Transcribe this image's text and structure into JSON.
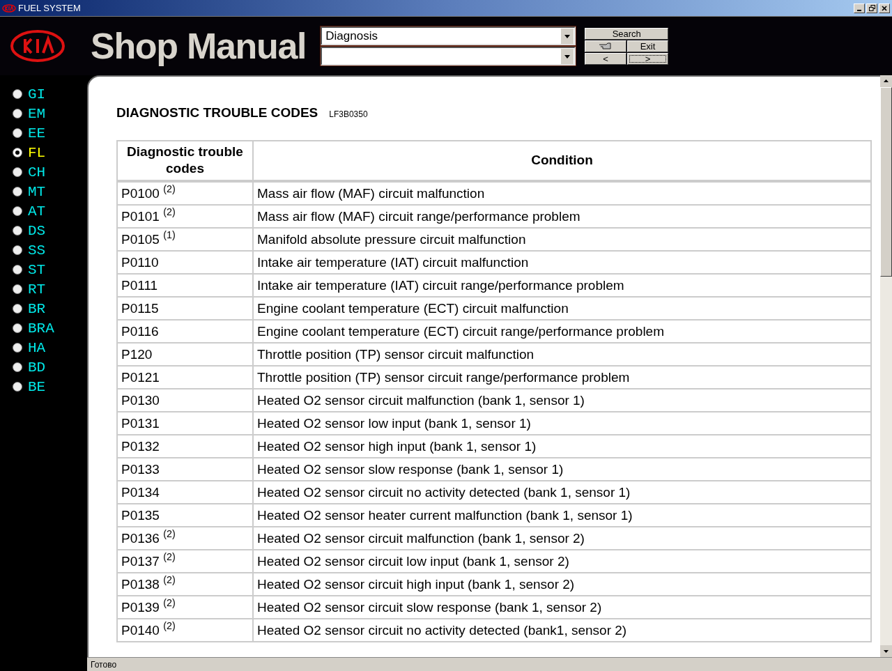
{
  "window": {
    "title": "FUEL SYSTEM"
  },
  "header": {
    "title": "Shop Manual",
    "selects": [
      {
        "kind": "filled",
        "value": "Diagnosis"
      },
      {
        "kind": "empty"
      }
    ],
    "buttons": [
      {
        "kind": "text",
        "label": "Search"
      },
      {
        "kind": "icon"
      },
      {
        "kind": "text",
        "label": "Exit"
      },
      {
        "kind": "text",
        "label": "<"
      },
      {
        "kind": "text",
        "label": ">",
        "focused": true
      }
    ]
  },
  "sidebar": {
    "items": [
      {
        "label": "GI",
        "selected": false
      },
      {
        "label": "EM",
        "selected": false
      },
      {
        "label": "EE",
        "selected": false
      },
      {
        "label": "FL",
        "selected": true
      },
      {
        "label": "CH",
        "selected": false
      },
      {
        "label": "MT",
        "selected": false
      },
      {
        "label": "AT",
        "selected": false
      },
      {
        "label": "DS",
        "selected": false
      },
      {
        "label": "SS",
        "selected": false
      },
      {
        "label": "ST",
        "selected": false
      },
      {
        "label": "RT",
        "selected": false
      },
      {
        "label": "BR",
        "selected": false
      },
      {
        "label": "BRA",
        "selected": false
      },
      {
        "label": "HA",
        "selected": false
      },
      {
        "label": "BD",
        "selected": false
      },
      {
        "label": "BE",
        "selected": false
      }
    ]
  },
  "document": {
    "title": "DIAGNOSTIC TROUBLE CODES",
    "doc_id": "LF3B0350"
  },
  "table": {
    "columns": [
      "Diagnostic trouble codes",
      "Condition"
    ],
    "rows": [
      {
        "code": "P0100 $^{(2)}$",
        "condition": "Mass air flow (MAF) circuit malfunction"
      },
      {
        "code": "P0101 $^{(2)}$",
        "condition": "Mass air flow (MAF) circuit range/performance problem"
      },
      {
        "code": "P0105 $^{(1)}$",
        "condition": "Manifold absolute pressure circuit malfunction"
      },
      {
        "code": "P0110",
        "condition": "Intake air temperature (IAT) circuit malfunction"
      },
      {
        "code": "P0111",
        "condition": "Intake air temperature (IAT) circuit range/performance problem"
      },
      {
        "code": "P0115",
        "condition": "Engine coolant temperature (ECT) circuit malfunction"
      },
      {
        "code": "P0116",
        "condition": "Engine coolant temperature (ECT) circuit range/performance problem"
      },
      {
        "code": "P120",
        "condition": "Throttle position (TP) sensor circuit malfunction"
      },
      {
        "code": "P0121",
        "condition": "Throttle position (TP) sensor circuit range/performance problem"
      },
      {
        "code": "P0130",
        "condition": "Heated O2 sensor circuit malfunction (bank 1, sensor 1)"
      },
      {
        "code": "P0131",
        "condition": "Heated O2 sensor low input (bank 1, sensor 1)"
      },
      {
        "code": "P0132",
        "condition": "Heated O2 sensor high input (bank 1, sensor 1)"
      },
      {
        "code": "P0133",
        "condition": "Heated O2 sensor slow response (bank 1, sensor 1)"
      },
      {
        "code": "P0134",
        "condition": "Heated O2 sensor circuit no activity detected (bank 1, sensor 1)"
      },
      {
        "code": "P0135",
        "condition": "Heated O2 sensor heater current malfunction (bank 1, sensor 1)"
      },
      {
        "code": "P0136 $^{(2)}$",
        "condition": "Heated O2 sensor circuit malfunction (bank 1, sensor 2)"
      },
      {
        "code": "P0137 $^{(2)}$",
        "condition": "Heated O2 sensor circuit low input (bank 1, sensor 2)"
      },
      {
        "code": "P0138 $^{(2)}$",
        "condition": "Heated O2 sensor circuit high input (bank 1, sensor 2)"
      },
      {
        "code": "P0139 $^{(2)}$",
        "condition": "Heated O2 sensor circuit slow response (bank 1, sensor 2)"
      },
      {
        "code": "P0140 $^{(2)}$",
        "condition": "Heated O2 sensor circuit no activity detected (bank1, sensor 2)"
      }
    ]
  },
  "status_bar": {
    "text": "Готово"
  }
}
